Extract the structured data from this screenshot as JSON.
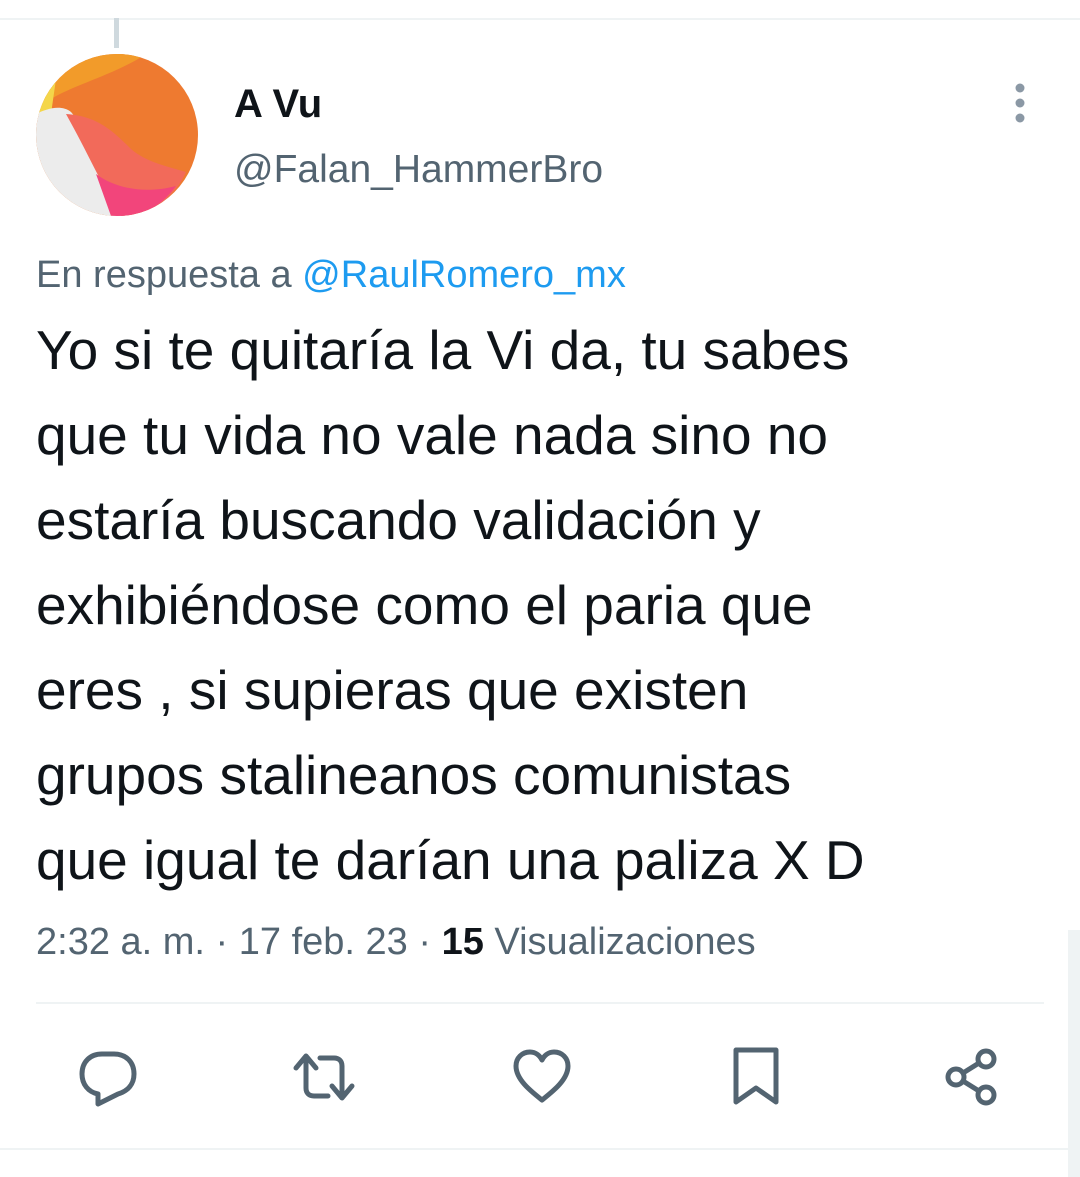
{
  "tweet": {
    "author": {
      "display_name": "A Vu",
      "handle": "@Falan_HammerBro"
    },
    "reply_context": {
      "prefix": "En respuesta a ",
      "mention": "@RaulRomero_mx"
    },
    "text": "Yo si te quitaría la Vi da, tu sabes\nque tu vida no vale nada sino no\nestaría buscando validación y\nexhibiéndose como el paria que\neres , si supieras que existen\ngrupos stalineanos comunistas\nque igual te darían una paliza  X D",
    "meta": {
      "time": "2:32 a. m.",
      "separator": " · ",
      "date": "17 feb. 23",
      "views_count": "15",
      "views_label": " Visualizaciones"
    }
  },
  "icons": {
    "more": "more-vertical-icon",
    "reply": "reply-icon",
    "retweet": "retweet-icon",
    "like": "like-icon",
    "bookmark": "bookmark-icon",
    "share": "share-icon"
  },
  "colors": {
    "text_primary": "#0f1419",
    "text_secondary": "#536471",
    "link": "#1d9bf0",
    "divider": "#eff3f4"
  }
}
